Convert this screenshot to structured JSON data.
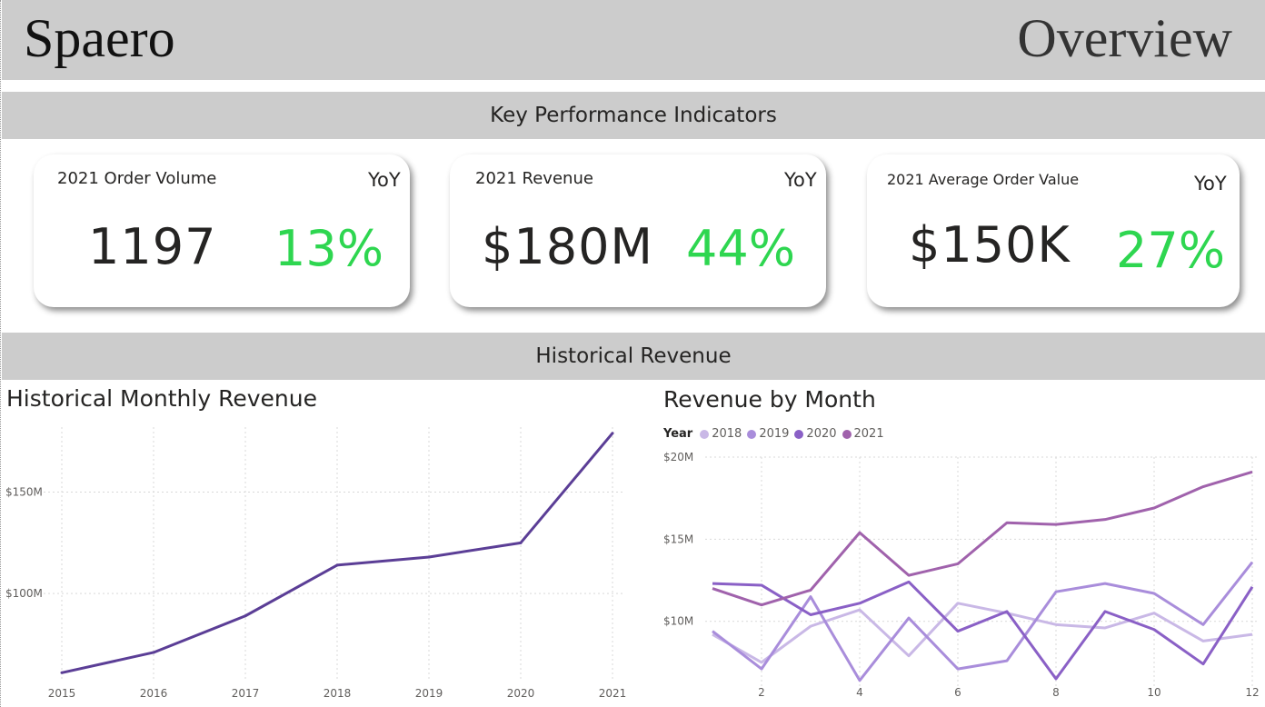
{
  "header": {
    "brand": "Spaero",
    "page_title": "Overview"
  },
  "kpi_section": {
    "title": "Key Performance Indicators"
  },
  "kpis": [
    {
      "title": "2021 Order Volume",
      "yoy_label": "YoY",
      "value": "1197",
      "yoy": "13%"
    },
    {
      "title": "2021 Revenue",
      "yoy_label": "YoY",
      "value": "$180M",
      "yoy": "44%"
    },
    {
      "title": "2021 Average Order Value",
      "yoy_label": "YoY",
      "value": "$150K",
      "yoy": "27%"
    }
  ],
  "history_section": {
    "title": "Historical Revenue"
  },
  "colors": {
    "positive": "#2ed650",
    "history_line": "#5b3e96"
  },
  "chart_data": [
    {
      "type": "line",
      "title": "Historical Monthly Revenue",
      "xlabel": "",
      "ylabel": "",
      "x": [
        2015,
        2016,
        2017,
        2018,
        2019,
        2020,
        2021
      ],
      "values": [
        61,
        71,
        89,
        114,
        118,
        125,
        179
      ],
      "ylim": [
        58,
        182
      ],
      "y_ticks": [
        100,
        150
      ],
      "y_tick_labels": [
        "$100M",
        "$150M"
      ],
      "grid": true
    },
    {
      "type": "line",
      "title": "Revenue by Month",
      "legend_title": "Year",
      "legend_position": "top-left",
      "xlabel": "",
      "ylabel": "",
      "x": [
        1,
        2,
        3,
        4,
        5,
        6,
        7,
        8,
        9,
        10,
        11,
        12
      ],
      "x_ticks": [
        2,
        4,
        6,
        8,
        10,
        12
      ],
      "y_ticks": [
        10,
        15,
        20
      ],
      "y_tick_labels": [
        "$10M",
        "$15M",
        "$20M"
      ],
      "ylim": [
        6,
        20
      ],
      "grid": true,
      "series": [
        {
          "name": "2018",
          "color": "#c9b8e6",
          "values": [
            9.2,
            7.5,
            9.7,
            10.7,
            7.9,
            11.1,
            10.5,
            9.8,
            9.6,
            10.5,
            8.8,
            9.2
          ]
        },
        {
          "name": "2019",
          "color": "#a98ddb",
          "values": [
            9.4,
            7.1,
            11.5,
            6.4,
            10.2,
            7.1,
            7.6,
            11.8,
            12.3,
            11.7,
            9.8,
            13.6
          ]
        },
        {
          "name": "2020",
          "color": "#8a60c6",
          "values": [
            12.3,
            12.2,
            10.4,
            11.1,
            12.4,
            9.4,
            10.6,
            6.5,
            10.6,
            9.5,
            7.4,
            12.1
          ]
        },
        {
          "name": "2021",
          "color": "#a062ac",
          "values": [
            12.0,
            11.0,
            11.9,
            15.4,
            12.8,
            13.5,
            16.0,
            15.9,
            16.2,
            16.9,
            18.2,
            19.1
          ]
        }
      ]
    }
  ]
}
